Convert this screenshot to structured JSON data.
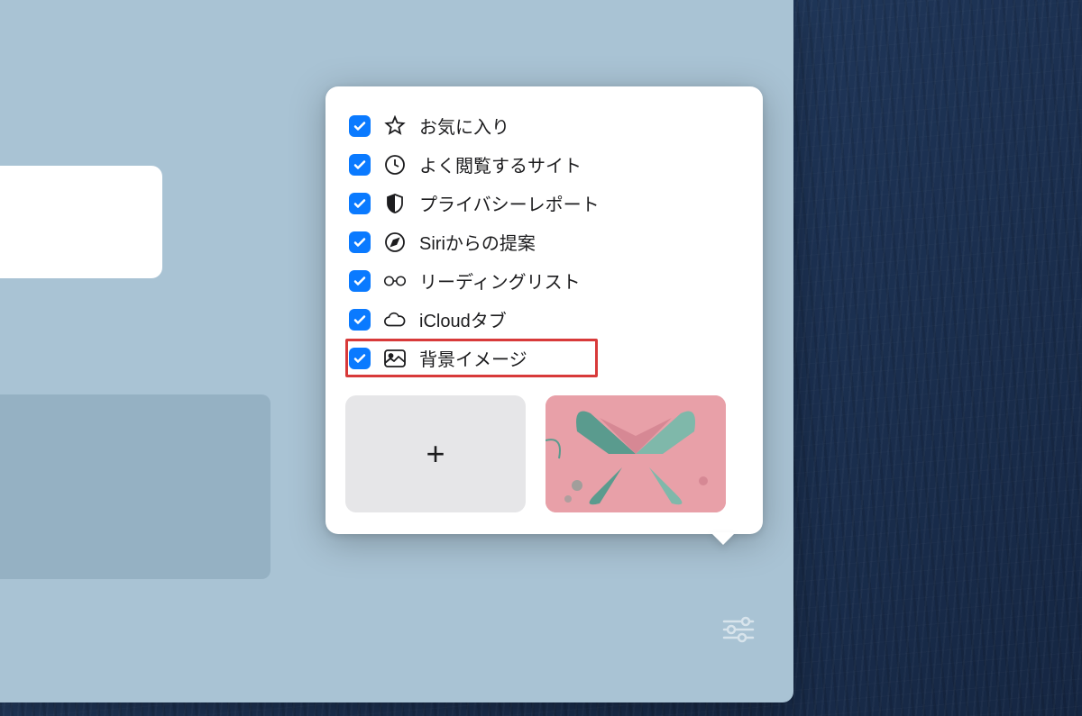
{
  "popover": {
    "options": [
      {
        "label": "お気に入り",
        "icon": "star",
        "checked": true,
        "highlighted": false
      },
      {
        "label": "よく閲覧するサイト",
        "icon": "clock",
        "checked": true,
        "highlighted": false
      },
      {
        "label": "プライバシーレポート",
        "icon": "shield",
        "checked": true,
        "highlighted": false
      },
      {
        "label": "Siriからの提案",
        "icon": "compass",
        "checked": true,
        "highlighted": false
      },
      {
        "label": "リーディングリスト",
        "icon": "glasses",
        "checked": true,
        "highlighted": false
      },
      {
        "label": "iCloudタブ",
        "icon": "cloud",
        "checked": true,
        "highlighted": false
      },
      {
        "label": "背景イメージ",
        "icon": "image",
        "checked": true,
        "highlighted": true
      }
    ],
    "thumbnails": {
      "add_label": "+"
    }
  }
}
